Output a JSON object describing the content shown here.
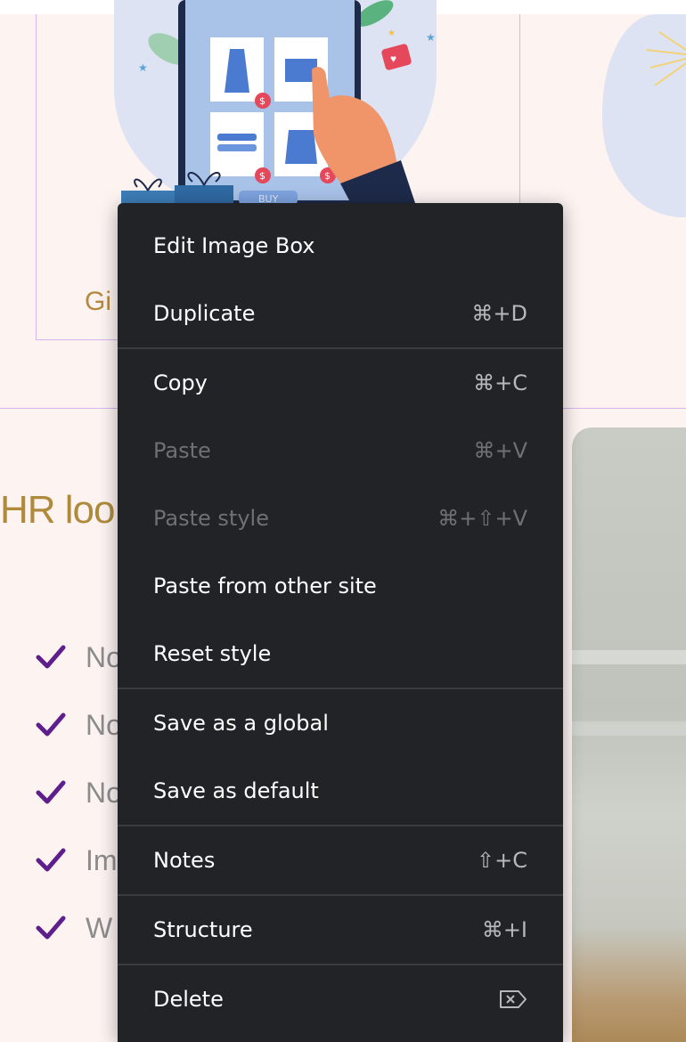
{
  "background": {
    "gift_title": "Gi",
    "hr_heading": "HR loo",
    "illustration": {
      "buy_label": "BUY",
      "price_symbol": "$"
    },
    "checklist": [
      {
        "text": "No",
        "icon": "checkmark-icon"
      },
      {
        "text": "No",
        "icon": "checkmark-icon"
      },
      {
        "text": "No",
        "icon": "checkmark-icon"
      },
      {
        "text": "Im",
        "icon": "checkmark-icon"
      },
      {
        "text": "W",
        "icon": "checkmark-icon"
      }
    ],
    "colors": {
      "page_bg": "#fdf4f2",
      "accent_gold": "#b08a3c",
      "check_purple": "#5e1e8c",
      "frame_outline": "#d7b6ee"
    }
  },
  "context_menu": {
    "items": [
      {
        "label": "Edit Image Box",
        "shortcut": "",
        "disabled": false
      },
      {
        "label": "Duplicate",
        "shortcut": "⌘+D",
        "disabled": false
      },
      {
        "label": "Copy",
        "shortcut": "⌘+C",
        "disabled": false
      },
      {
        "label": "Paste",
        "shortcut": "⌘+V",
        "disabled": true
      },
      {
        "label": "Paste style",
        "shortcut": "⌘+⇧+V",
        "disabled": true
      },
      {
        "label": "Paste from other site",
        "shortcut": "",
        "disabled": false
      },
      {
        "label": "Reset style",
        "shortcut": "",
        "disabled": false
      },
      {
        "label": "Save as a global",
        "shortcut": "",
        "disabled": false
      },
      {
        "label": "Save as default",
        "shortcut": "",
        "disabled": false
      },
      {
        "label": "Notes",
        "shortcut": "⇧+C",
        "disabled": false
      },
      {
        "label": "Structure",
        "shortcut": "⌘+I",
        "disabled": false
      },
      {
        "label": "Delete",
        "shortcut": "",
        "shortcut_icon": "delete-key-icon",
        "disabled": false
      }
    ],
    "colors": {
      "bg": "#222327",
      "text": "#ffffff",
      "disabled_text": "#6f7076"
    }
  }
}
